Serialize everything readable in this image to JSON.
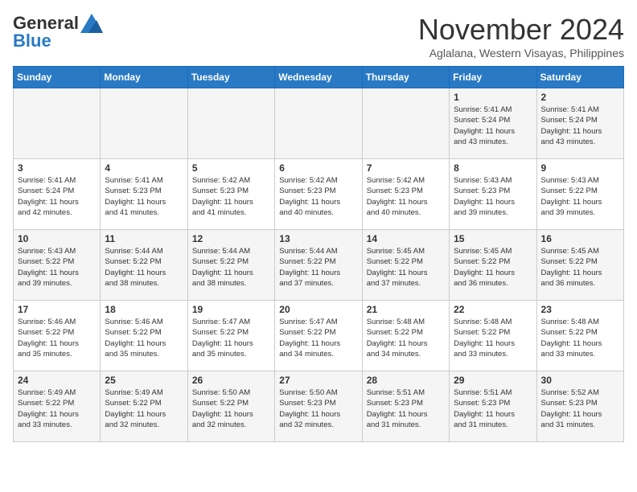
{
  "logo": {
    "general": "General",
    "blue": "Blue"
  },
  "title": "November 2024",
  "location": "Aglalana, Western Visayas, Philippines",
  "days_header": [
    "Sunday",
    "Monday",
    "Tuesday",
    "Wednesday",
    "Thursday",
    "Friday",
    "Saturday"
  ],
  "weeks": [
    [
      {
        "day": "",
        "info": ""
      },
      {
        "day": "",
        "info": ""
      },
      {
        "day": "",
        "info": ""
      },
      {
        "day": "",
        "info": ""
      },
      {
        "day": "",
        "info": ""
      },
      {
        "day": "1",
        "info": "Sunrise: 5:41 AM\nSunset: 5:24 PM\nDaylight: 11 hours\nand 43 minutes."
      },
      {
        "day": "2",
        "info": "Sunrise: 5:41 AM\nSunset: 5:24 PM\nDaylight: 11 hours\nand 43 minutes."
      }
    ],
    [
      {
        "day": "3",
        "info": "Sunrise: 5:41 AM\nSunset: 5:24 PM\nDaylight: 11 hours\nand 42 minutes."
      },
      {
        "day": "4",
        "info": "Sunrise: 5:41 AM\nSunset: 5:23 PM\nDaylight: 11 hours\nand 41 minutes."
      },
      {
        "day": "5",
        "info": "Sunrise: 5:42 AM\nSunset: 5:23 PM\nDaylight: 11 hours\nand 41 minutes."
      },
      {
        "day": "6",
        "info": "Sunrise: 5:42 AM\nSunset: 5:23 PM\nDaylight: 11 hours\nand 40 minutes."
      },
      {
        "day": "7",
        "info": "Sunrise: 5:42 AM\nSunset: 5:23 PM\nDaylight: 11 hours\nand 40 minutes."
      },
      {
        "day": "8",
        "info": "Sunrise: 5:43 AM\nSunset: 5:23 PM\nDaylight: 11 hours\nand 39 minutes."
      },
      {
        "day": "9",
        "info": "Sunrise: 5:43 AM\nSunset: 5:22 PM\nDaylight: 11 hours\nand 39 minutes."
      }
    ],
    [
      {
        "day": "10",
        "info": "Sunrise: 5:43 AM\nSunset: 5:22 PM\nDaylight: 11 hours\nand 39 minutes."
      },
      {
        "day": "11",
        "info": "Sunrise: 5:44 AM\nSunset: 5:22 PM\nDaylight: 11 hours\nand 38 minutes."
      },
      {
        "day": "12",
        "info": "Sunrise: 5:44 AM\nSunset: 5:22 PM\nDaylight: 11 hours\nand 38 minutes."
      },
      {
        "day": "13",
        "info": "Sunrise: 5:44 AM\nSunset: 5:22 PM\nDaylight: 11 hours\nand 37 minutes."
      },
      {
        "day": "14",
        "info": "Sunrise: 5:45 AM\nSunset: 5:22 PM\nDaylight: 11 hours\nand 37 minutes."
      },
      {
        "day": "15",
        "info": "Sunrise: 5:45 AM\nSunset: 5:22 PM\nDaylight: 11 hours\nand 36 minutes."
      },
      {
        "day": "16",
        "info": "Sunrise: 5:45 AM\nSunset: 5:22 PM\nDaylight: 11 hours\nand 36 minutes."
      }
    ],
    [
      {
        "day": "17",
        "info": "Sunrise: 5:46 AM\nSunset: 5:22 PM\nDaylight: 11 hours\nand 35 minutes."
      },
      {
        "day": "18",
        "info": "Sunrise: 5:46 AM\nSunset: 5:22 PM\nDaylight: 11 hours\nand 35 minutes."
      },
      {
        "day": "19",
        "info": "Sunrise: 5:47 AM\nSunset: 5:22 PM\nDaylight: 11 hours\nand 35 minutes."
      },
      {
        "day": "20",
        "info": "Sunrise: 5:47 AM\nSunset: 5:22 PM\nDaylight: 11 hours\nand 34 minutes."
      },
      {
        "day": "21",
        "info": "Sunrise: 5:48 AM\nSunset: 5:22 PM\nDaylight: 11 hours\nand 34 minutes."
      },
      {
        "day": "22",
        "info": "Sunrise: 5:48 AM\nSunset: 5:22 PM\nDaylight: 11 hours\nand 33 minutes."
      },
      {
        "day": "23",
        "info": "Sunrise: 5:48 AM\nSunset: 5:22 PM\nDaylight: 11 hours\nand 33 minutes."
      }
    ],
    [
      {
        "day": "24",
        "info": "Sunrise: 5:49 AM\nSunset: 5:22 PM\nDaylight: 11 hours\nand 33 minutes."
      },
      {
        "day": "25",
        "info": "Sunrise: 5:49 AM\nSunset: 5:22 PM\nDaylight: 11 hours\nand 32 minutes."
      },
      {
        "day": "26",
        "info": "Sunrise: 5:50 AM\nSunset: 5:22 PM\nDaylight: 11 hours\nand 32 minutes."
      },
      {
        "day": "27",
        "info": "Sunrise: 5:50 AM\nSunset: 5:23 PM\nDaylight: 11 hours\nand 32 minutes."
      },
      {
        "day": "28",
        "info": "Sunrise: 5:51 AM\nSunset: 5:23 PM\nDaylight: 11 hours\nand 31 minutes."
      },
      {
        "day": "29",
        "info": "Sunrise: 5:51 AM\nSunset: 5:23 PM\nDaylight: 11 hours\nand 31 minutes."
      },
      {
        "day": "30",
        "info": "Sunrise: 5:52 AM\nSunset: 5:23 PM\nDaylight: 11 hours\nand 31 minutes."
      }
    ]
  ]
}
